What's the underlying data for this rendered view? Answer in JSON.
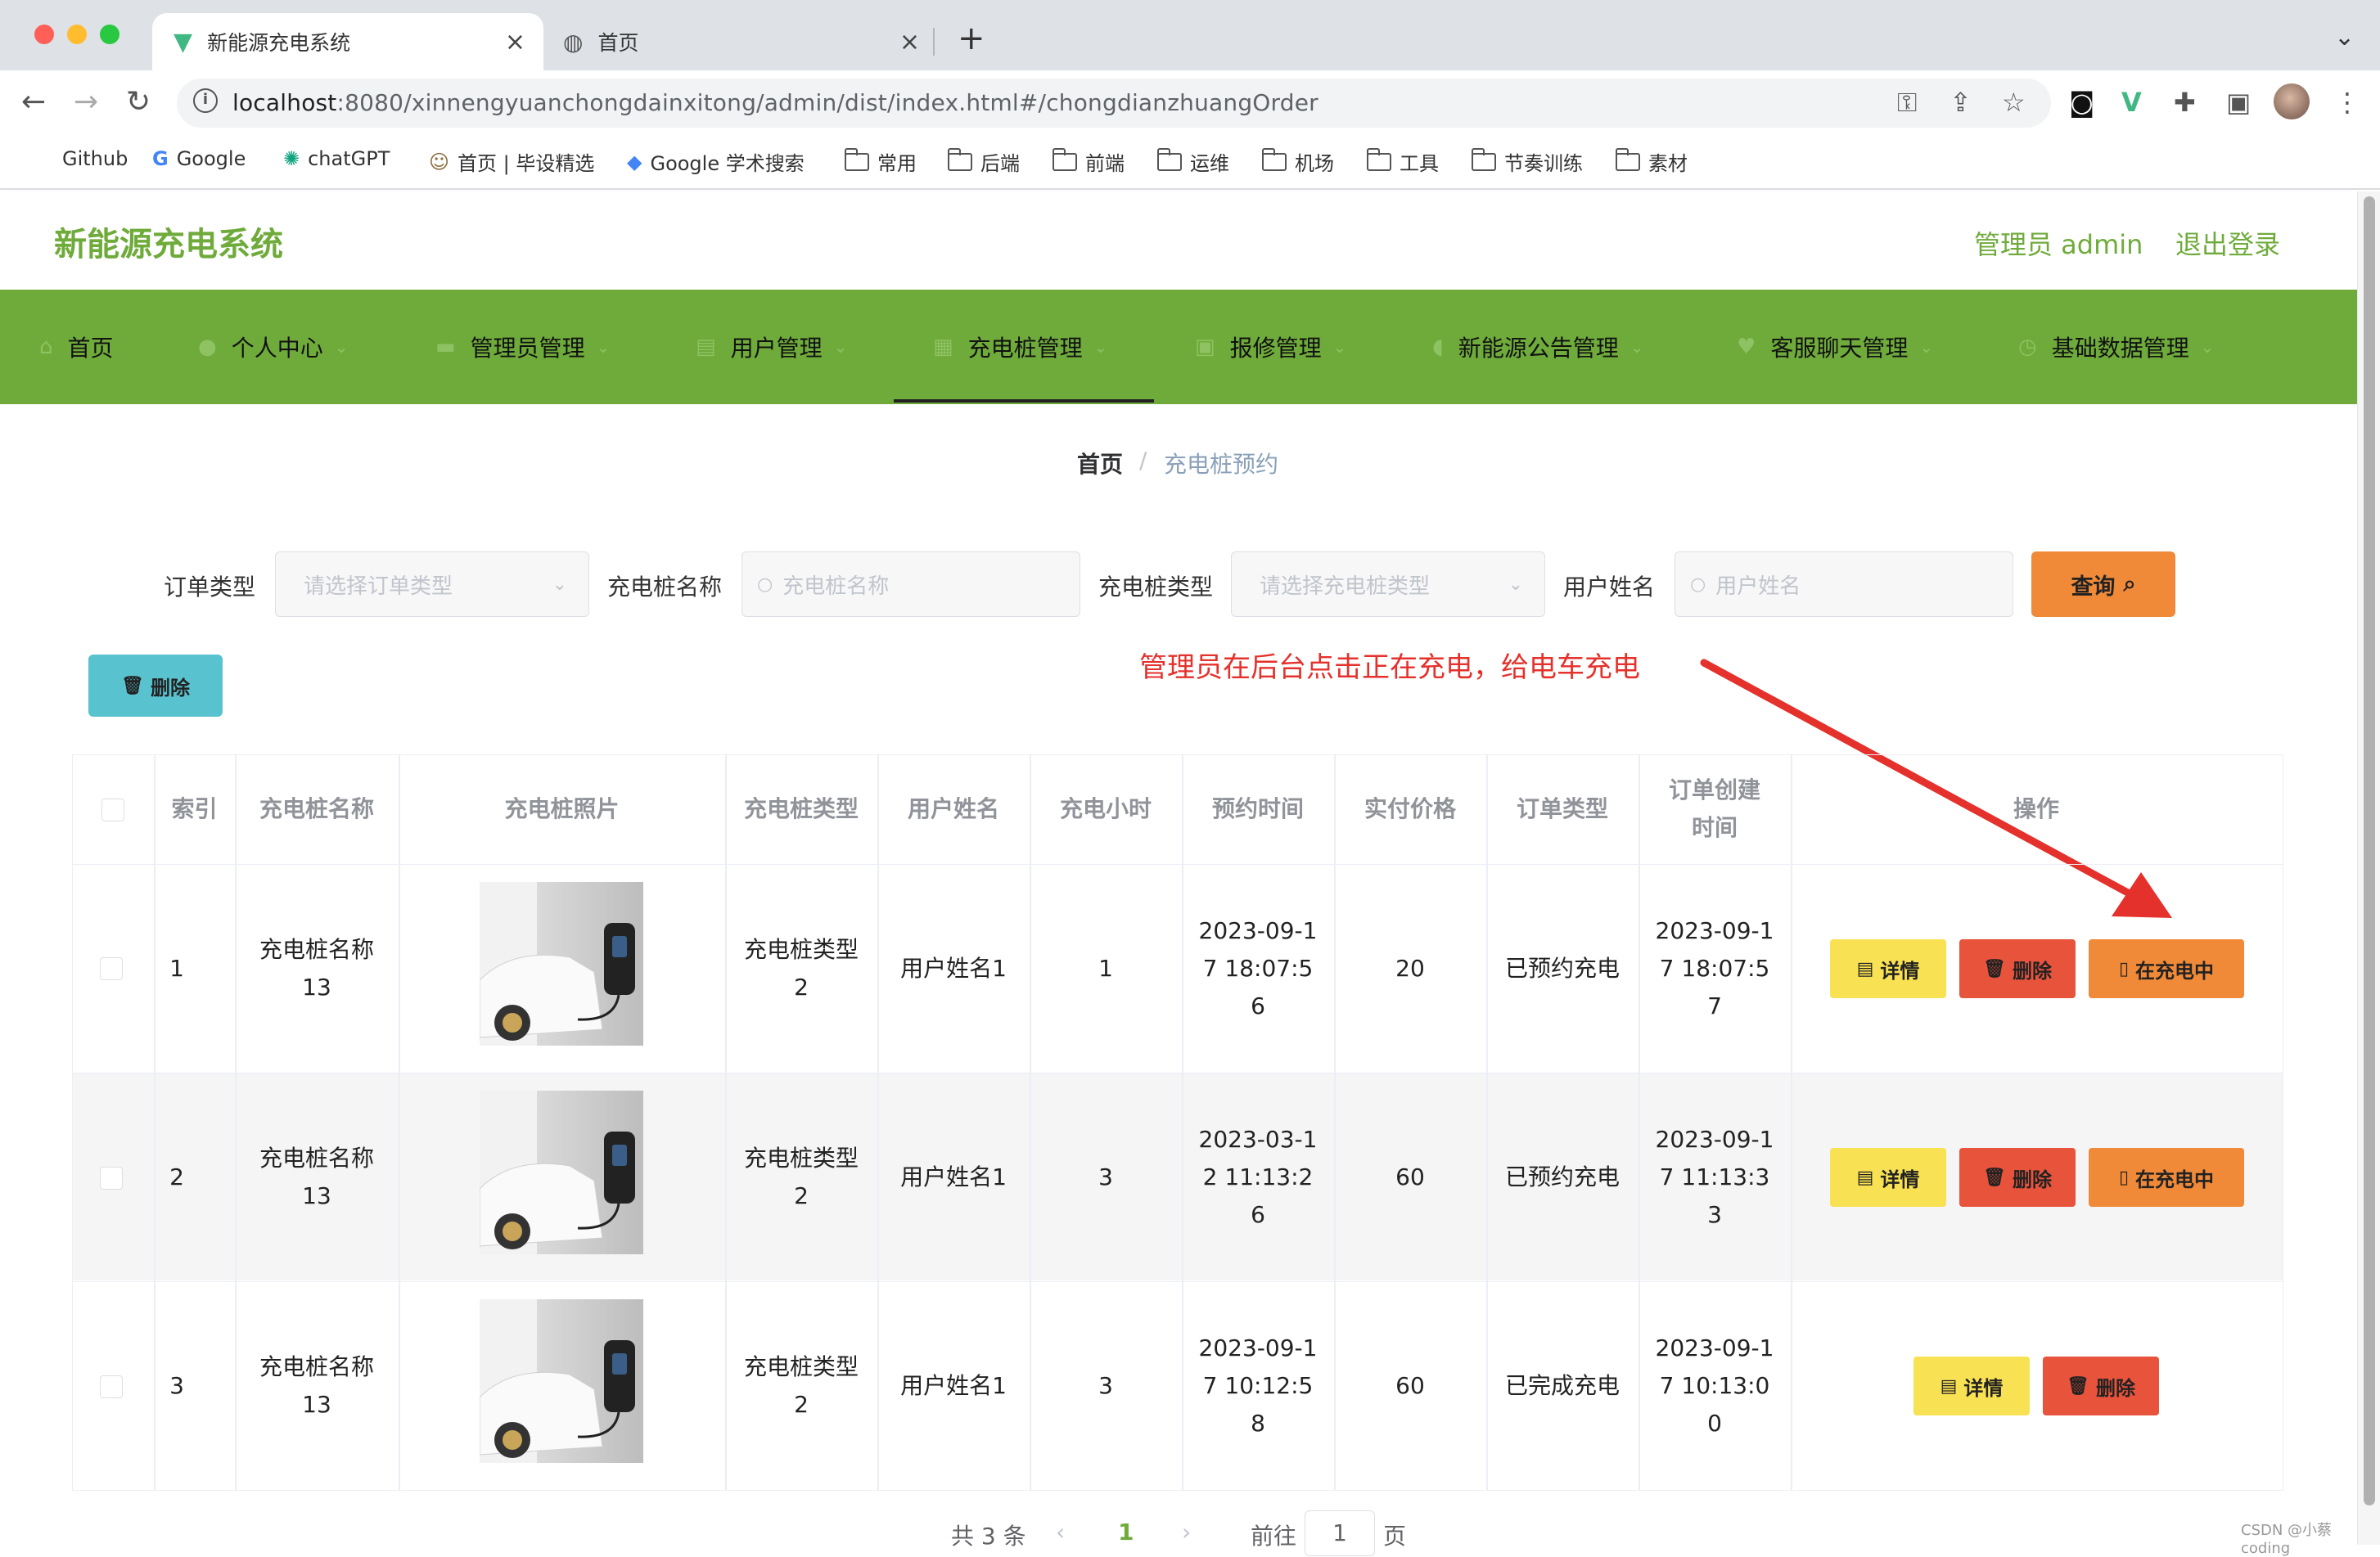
{
  "browser": {
    "tabs": [
      {
        "title": "新能源充电系统",
        "icon": "vue-icon"
      },
      {
        "title": "首页",
        "icon": "globe-icon"
      }
    ],
    "url_host": "localhost",
    "url_path": ":8080/xinnengyuanchongdainxitong/admin/dist/index.html#/chongdianzhuangOrder",
    "bookmarks": [
      "Github",
      "Google",
      "chatGPT",
      "首页 | 毕设精选",
      "Google 学术搜索",
      "常用",
      "后端",
      "前端",
      "运维",
      "机场",
      "工具",
      "节奏训练",
      "素材"
    ]
  },
  "app": {
    "logo": "新能源充电系统",
    "admin": "管理员 admin",
    "logout": "退出登录",
    "nav": [
      {
        "label": "首页",
        "icon": "home-icon"
      },
      {
        "label": "个人中心",
        "icon": "user-icon"
      },
      {
        "label": "管理员管理",
        "icon": "admin-icon"
      },
      {
        "label": "用户管理",
        "icon": "users-icon"
      },
      {
        "label": "充电桩管理",
        "icon": "grid-icon"
      },
      {
        "label": "报修管理",
        "icon": "repair-icon"
      },
      {
        "label": "新能源公告管理",
        "icon": "notice-icon"
      },
      {
        "label": "客服聊天管理",
        "icon": "chat-icon"
      },
      {
        "label": "基础数据管理",
        "icon": "data-icon"
      }
    ],
    "breadcrumb": {
      "home": "首页",
      "sep": "/",
      "current": "充电桩预约"
    }
  },
  "filters": {
    "order_type_label": "订单类型",
    "order_type_placeholder": "请选择订单类型",
    "pile_name_label": "充电桩名称",
    "pile_name_placeholder": "充电桩名称",
    "pile_type_label": "充电桩类型",
    "pile_type_placeholder": "请选择充电桩类型",
    "user_name_label": "用户姓名",
    "user_name_placeholder": "用户姓名",
    "query_button": "查询",
    "delete_button": "删除"
  },
  "annotation": "管理员在后台点击正在充电，给电车充电",
  "table": {
    "columns": [
      "索引",
      "充电桩名称",
      "充电桩照片",
      "充电桩类型",
      "用户姓名",
      "充电小时",
      "预约时间",
      "实付价格",
      "订单类型",
      "订单创建时间",
      "操作"
    ],
    "rows": [
      {
        "index": "1",
        "name": "充电桩名称13",
        "type": "充电桩类型2",
        "user": "用户姓名1",
        "hours": "1",
        "reserve_time": "2023-09-17 18:07:56",
        "price": "20",
        "order_type": "已预约充电",
        "created": "2023-09-17 18:07:57"
      },
      {
        "index": "2",
        "name": "充电桩名称13",
        "type": "充电桩类型2",
        "user": "用户姓名1",
        "hours": "3",
        "reserve_time": "2023-03-12 11:13:26",
        "price": "60",
        "order_type": "已预约充电",
        "created": "2023-09-17 11:13:33"
      },
      {
        "index": "3",
        "name": "充电桩名称13",
        "type": "充电桩类型2",
        "user": "用户姓名1",
        "hours": "3",
        "reserve_time": "2023-09-17 10:12:58",
        "price": "60",
        "order_type": "已完成充电",
        "created": "2023-09-17 10:13:00"
      }
    ],
    "actions": {
      "detail": "详情",
      "delete": "删除",
      "charging": "在充电中"
    }
  },
  "pagination": {
    "total": "共 3 条",
    "prev": "‹",
    "current": "1",
    "next": "›",
    "goto": "前往",
    "goto_value": "1",
    "page_unit": "页"
  },
  "watermark": "CSDN @小蔡coding",
  "colors": {
    "brand": "#6fab3b",
    "detail": "#f9e154",
    "delete": "#e8533c",
    "charging": "#f08a38",
    "query": "#f08a38",
    "delete_top": "#58c2cf",
    "annotation": "#e5312c"
  }
}
